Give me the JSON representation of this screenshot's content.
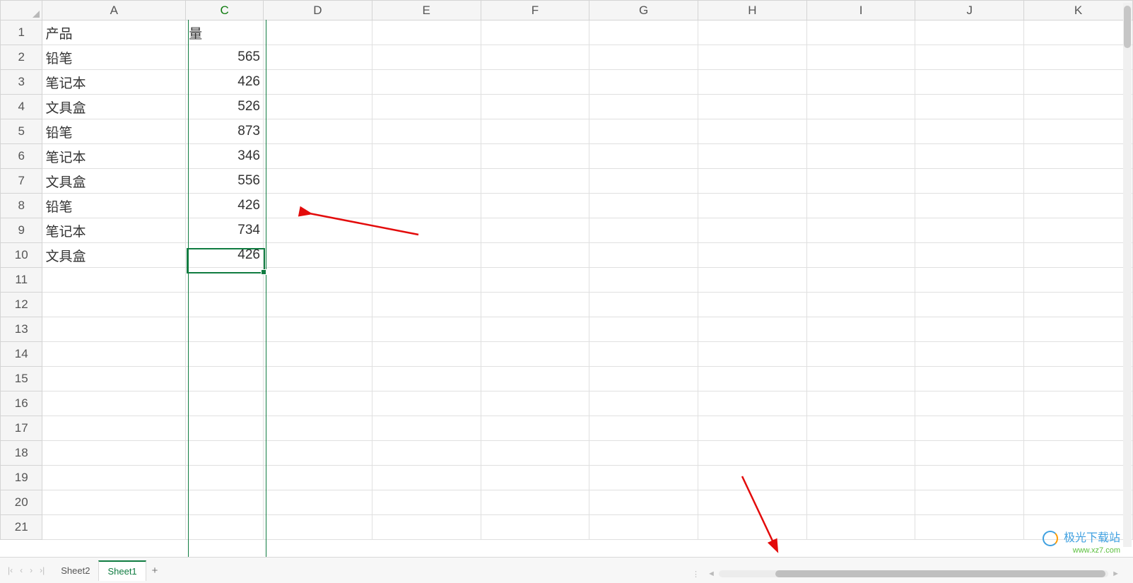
{
  "columns": [
    "A",
    "C",
    "D",
    "E",
    "F",
    "G",
    "H",
    "I",
    "J",
    "K"
  ],
  "selectedColumn": "C",
  "rowCount": 21,
  "activeCell": {
    "row": 10,
    "col": "C"
  },
  "cells": {
    "A1": "产品",
    "C1": "量",
    "A2": "铅笔",
    "C2": "565",
    "A3": "笔记本",
    "C3": "426",
    "A4": "文具盒",
    "C4": "526",
    "A5": "铅笔",
    "C5": "873",
    "A6": "笔记本",
    "C6": "346",
    "A7": "文具盒",
    "C7": "556",
    "A8": "铅笔",
    "C8": "426",
    "A9": "笔记本",
    "C9": "734",
    "A10": "文具盒",
    "C10": "426"
  },
  "tabs": {
    "nav": {
      "first": "⏮",
      "prev": "‹",
      "next": "›",
      "last": "⏭"
    },
    "items": [
      "Sheet2",
      "Sheet1"
    ],
    "active": "Sheet1",
    "add": "+"
  },
  "watermark": {
    "brand": "极光下载站",
    "url": "www.xz7.com"
  }
}
